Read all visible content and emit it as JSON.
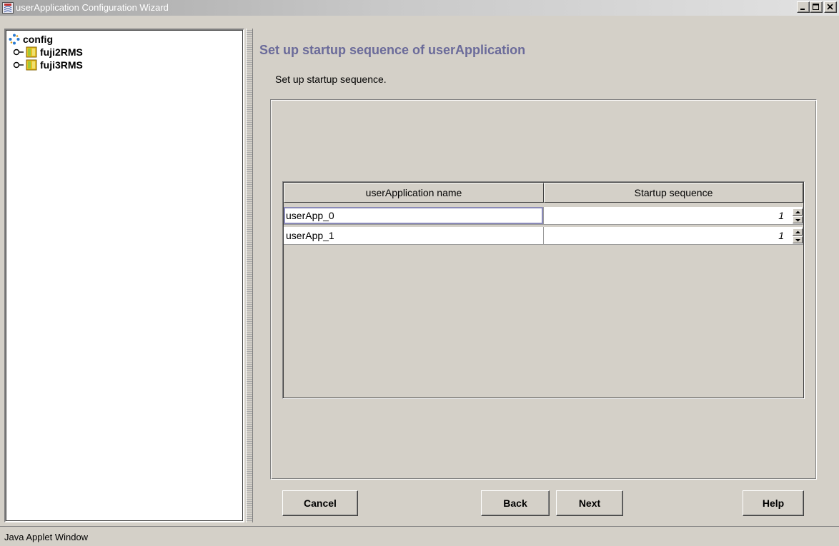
{
  "window": {
    "title": "userApplication Configuration Wizard",
    "icon": "java-applet-icon",
    "controls": [
      "minimize-icon",
      "maximize-icon",
      "close-icon"
    ]
  },
  "tree": {
    "root": {
      "label": "config",
      "icon": "config-node-icon"
    },
    "items": [
      {
        "label": "fuji2RMS",
        "icon": "folder-icon",
        "expander": "tree-expander-icon"
      },
      {
        "label": "fuji3RMS",
        "icon": "folder-icon",
        "expander": "tree-expander-icon"
      }
    ]
  },
  "main": {
    "title": "Set up startup sequence of userApplication",
    "subtitle": "Set up startup sequence."
  },
  "table": {
    "columns": [
      "userApplication name",
      "Startup sequence"
    ],
    "rows": [
      {
        "name": "userApp_0",
        "sequence": "1"
      },
      {
        "name": "userApp_1",
        "sequence": "1"
      }
    ]
  },
  "buttons": {
    "cancel": "Cancel",
    "back": "Back",
    "next": "Next",
    "help": "Help"
  },
  "status": {
    "text": "Java Applet Window"
  },
  "colors": {
    "window_bg": "#d4d0c8",
    "title_color": "#6b6b9a"
  }
}
